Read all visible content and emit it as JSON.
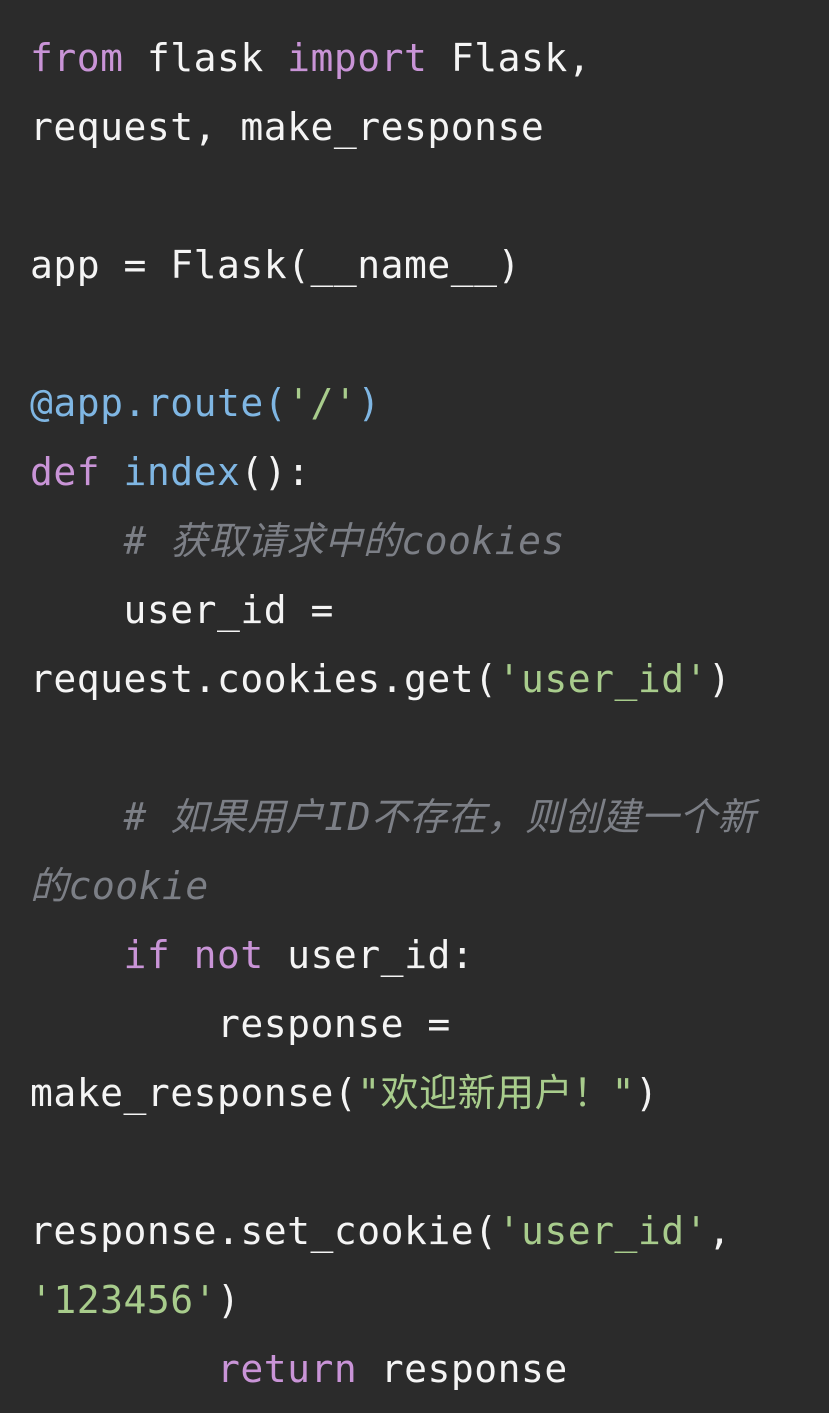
{
  "language": "python",
  "colors": {
    "background": "#2b2b2b",
    "keyword": "#c994d7",
    "function": "#7fb6e3",
    "string": "#a8cc8c",
    "comment": "#7c7f86",
    "plain": "#f4f4f4"
  },
  "lines": [
    [
      {
        "t": "kw",
        "v": "from"
      },
      {
        "t": "pl",
        "v": " flask "
      },
      {
        "t": "kw",
        "v": "import"
      },
      {
        "t": "pl",
        "v": " Flask,"
      }
    ],
    [
      {
        "t": "pl",
        "v": "request, make_response"
      }
    ],
    [],
    [
      {
        "t": "pl",
        "v": "app = Flask(__name__)"
      }
    ],
    [],
    [
      {
        "t": "fn",
        "v": "@app.route("
      },
      {
        "t": "str",
        "v": "'/'"
      },
      {
        "t": "fn",
        "v": ")"
      }
    ],
    [
      {
        "t": "kw",
        "v": "def"
      },
      {
        "t": "pl",
        "v": " "
      },
      {
        "t": "fn",
        "v": "index"
      },
      {
        "t": "pl",
        "v": "():"
      }
    ],
    [
      {
        "t": "cm",
        "v": "    # 获取请求中的cookies"
      }
    ],
    [
      {
        "t": "pl",
        "v": "    user_id ="
      }
    ],
    [
      {
        "t": "pl",
        "v": "request.cookies.get("
      },
      {
        "t": "str",
        "v": "'user_id'"
      },
      {
        "t": "pl",
        "v": ")"
      }
    ],
    [],
    [
      {
        "t": "cm",
        "v": "    # 如果用户ID不存在，则创建一个新"
      }
    ],
    [
      {
        "t": "cm",
        "v": "的cookie"
      }
    ],
    [
      {
        "t": "pl",
        "v": "    "
      },
      {
        "t": "kw",
        "v": "if not"
      },
      {
        "t": "pl",
        "v": " user_id:"
      }
    ],
    [
      {
        "t": "pl",
        "v": "        response ="
      }
    ],
    [
      {
        "t": "pl",
        "v": "make_response("
      },
      {
        "t": "str",
        "v": "\"欢迎新用户！\""
      },
      {
        "t": "pl",
        "v": ")"
      }
    ],
    [],
    [
      {
        "t": "pl",
        "v": "response.set_cookie("
      },
      {
        "t": "str",
        "v": "'user_id'"
      },
      {
        "t": "pl",
        "v": ","
      }
    ],
    [
      {
        "t": "str",
        "v": "'123456'"
      },
      {
        "t": "pl",
        "v": ")"
      }
    ],
    [
      {
        "t": "pl",
        "v": "        "
      },
      {
        "t": "kw",
        "v": "return"
      },
      {
        "t": "pl",
        "v": " response"
      }
    ]
  ]
}
